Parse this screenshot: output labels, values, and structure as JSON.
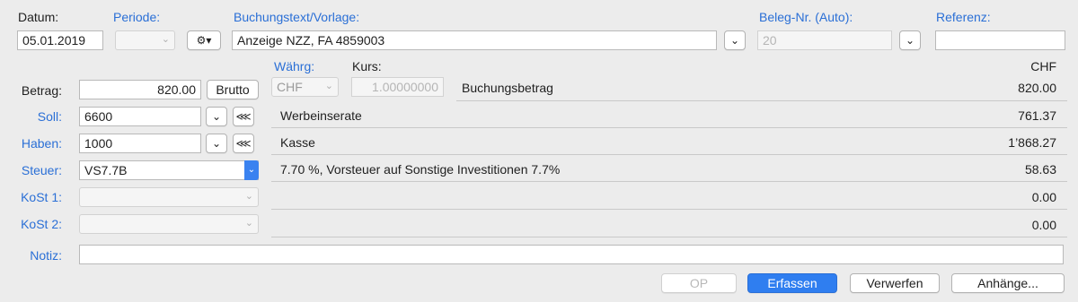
{
  "header": {
    "datum_label": "Datum:",
    "periode_label": "Periode:",
    "buchungstext_label": "Buchungstext/Vorlage:",
    "belegnr_label": "Beleg-Nr. (Auto):",
    "referenz_label": "Referenz:",
    "datum_value": "05.01.2019",
    "buchungstext_value": "Anzeige NZZ, FA 4859003",
    "belegnr_placeholder": "20",
    "referenz_value": ""
  },
  "currency": {
    "waehrung_label": "Währg:",
    "kurs_label": "Kurs:",
    "chf_header": "CHF",
    "waehrung_value": "CHF",
    "kurs_value": "1.00000000"
  },
  "form": {
    "betrag_label": "Betrag:",
    "betrag_value": "820.00",
    "brutto_label": "Brutto",
    "soll_label": "Soll:",
    "soll_value": "6600",
    "haben_label": "Haben:",
    "haben_value": "1000",
    "steuer_label": "Steuer:",
    "steuer_value": "VS7.7B",
    "kost1_label": "KoSt 1:",
    "kost2_label": "KoSt 2:",
    "notiz_label": "Notiz:",
    "notiz_value": ""
  },
  "details": [
    {
      "text": "Buchungsbetrag",
      "amount": "820.00"
    },
    {
      "text": "Werbeinserate",
      "amount": "761.37"
    },
    {
      "text": "Kasse",
      "amount": "1’868.27"
    },
    {
      "text": "7.70 %, Vorsteuer auf Sonstige Investitionen 7.7%",
      "amount": "58.63"
    },
    {
      "text": "",
      "amount": "0.00"
    },
    {
      "text": "",
      "amount": "0.00"
    }
  ],
  "buttons": {
    "op": "OP",
    "erfassen": "Erfassen",
    "verwerfen": "Verwerfen",
    "anhaenge": "Anhänge..."
  },
  "icons": {
    "gear": "gear-icon",
    "chevron": "chevron-down-icon",
    "share": "share-icon"
  },
  "colors": {
    "accent_label": "#2a6fd6",
    "primary_button": "#2f7ef0",
    "background": "#ececec"
  }
}
